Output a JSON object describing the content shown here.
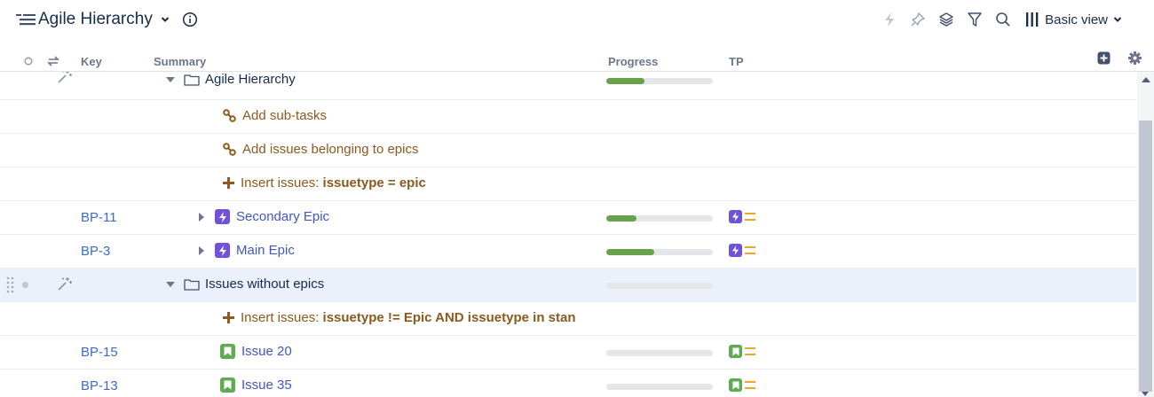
{
  "header": {
    "title": "Agile Hierarchy",
    "view_label": "Basic view"
  },
  "columns": {
    "key": "Key",
    "summary": "Summary",
    "progress": "Progress",
    "tp": "TP"
  },
  "rows": [
    {
      "key": "",
      "summary": "Agile Hierarchy",
      "progress": 0.36
    },
    {
      "key": "",
      "summary": "Add sub-tasks"
    },
    {
      "key": "",
      "summary": "Add issues belonging to epics"
    },
    {
      "key": "",
      "summary_prefix": "Insert issues: ",
      "summary_bold": "issuetype = epic"
    },
    {
      "key": "BP-11",
      "summary": "Secondary Epic",
      "progress": 0.28,
      "tp_type": "epic",
      "priority": "medium"
    },
    {
      "key": "BP-3",
      "summary": "Main Epic",
      "progress": 0.45,
      "tp_type": "epic",
      "priority": "medium"
    },
    {
      "key": "",
      "summary": "Issues without epics",
      "progress": 0.0
    },
    {
      "key": "",
      "summary_prefix": "Insert issues: ",
      "summary_bold": "issuetype != Epic AND issuetype in stan"
    },
    {
      "key": "BP-15",
      "summary": "Issue 20",
      "progress": 0.0,
      "tp_type": "story",
      "priority": "medium"
    },
    {
      "key": "BP-13",
      "summary": "Issue 35",
      "progress": 0.0,
      "tp_type": "story",
      "priority": "medium"
    }
  ],
  "colors": {
    "epic": "#7251d9",
    "story": "#5faa53",
    "progress_fill": "#66a34c",
    "priority_medium": "#f2a32c",
    "key_link": "#3d6bc9",
    "generator_text": "#8b5a1e",
    "selected_row": "#ebf0fa"
  },
  "icons": {
    "title": "structure-hierarchy-icon",
    "toolbar": [
      "automation-bolt-icon",
      "pin-icon",
      "layers-icon",
      "filter-icon",
      "search-icon",
      "columns-icon"
    ]
  }
}
